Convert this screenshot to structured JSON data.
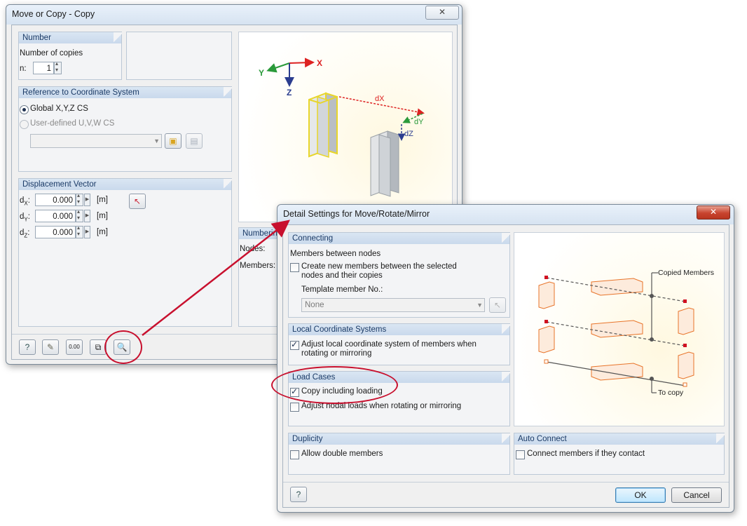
{
  "main_dialog": {
    "title": "Move or Copy - Copy",
    "close_glyph": "✕",
    "number": {
      "header": "Number",
      "copies_label": "Number of copies",
      "n_label": "n:",
      "n_value": "1"
    },
    "reference": {
      "header": "Reference to Coordinate System",
      "global_label": "Global X,Y,Z CS",
      "user_label": "User-defined U,V,W CS"
    },
    "displacement": {
      "header": "Displacement Vector",
      "rows": [
        {
          "label": "dX:",
          "value": "0.000",
          "unit": "[m]"
        },
        {
          "label": "dY:",
          "value": "0.000",
          "unit": "[m]"
        },
        {
          "label": "dZ:",
          "value": "0.000",
          "unit": "[m]"
        }
      ]
    },
    "numbering": {
      "header": "Numbering",
      "nodes_label": "Nodes:",
      "members_label": "Members:"
    },
    "preview": {
      "axis_x": "X",
      "axis_y": "Y",
      "axis_z": "Z",
      "dx": "dX",
      "dy": "dY",
      "dz": "dZ"
    },
    "toolbar_icons": [
      "help-icon",
      "edit-icon",
      "numeric-icon",
      "copy-icon",
      "detail-settings-icon"
    ]
  },
  "detail_dialog": {
    "title": "Detail Settings for Move/Rotate/Mirror",
    "close_glyph": "✕",
    "connecting": {
      "header": "Connecting",
      "members_between_label": "Members between nodes",
      "create_line1": "Create new members between the selected",
      "create_line2": "nodes and their copies",
      "create_checked": false,
      "template_label": "Template member No.:",
      "template_value": "None"
    },
    "local_cs": {
      "header": "Local Coordinate Systems",
      "adjust_line1": "Adjust local coordinate system of members when",
      "adjust_line2": "rotating or mirroring",
      "adjust_checked": true
    },
    "load_cases": {
      "header": "Load Cases",
      "copy_loading_label": "Copy including loading",
      "copy_loading_checked": true,
      "adjust_nodal_label": "Adjust nodal loads when rotating or mirroring",
      "adjust_nodal_checked": false
    },
    "duplicity": {
      "header": "Duplicity",
      "allow_double_label": "Allow double members",
      "allow_double_checked": false
    },
    "auto_connect": {
      "header": "Auto Connect",
      "connect_label": "Connect members if they contact",
      "connect_checked": false
    },
    "preview": {
      "copied_members_label": "Copied Members",
      "to_copy_label": "To copy"
    },
    "ok_label": "OK",
    "cancel_label": "Cancel"
  },
  "colors": {
    "highlight_red": "#c8102e",
    "accent_orange": "#e8742a",
    "group_header": "#1a3a66"
  }
}
